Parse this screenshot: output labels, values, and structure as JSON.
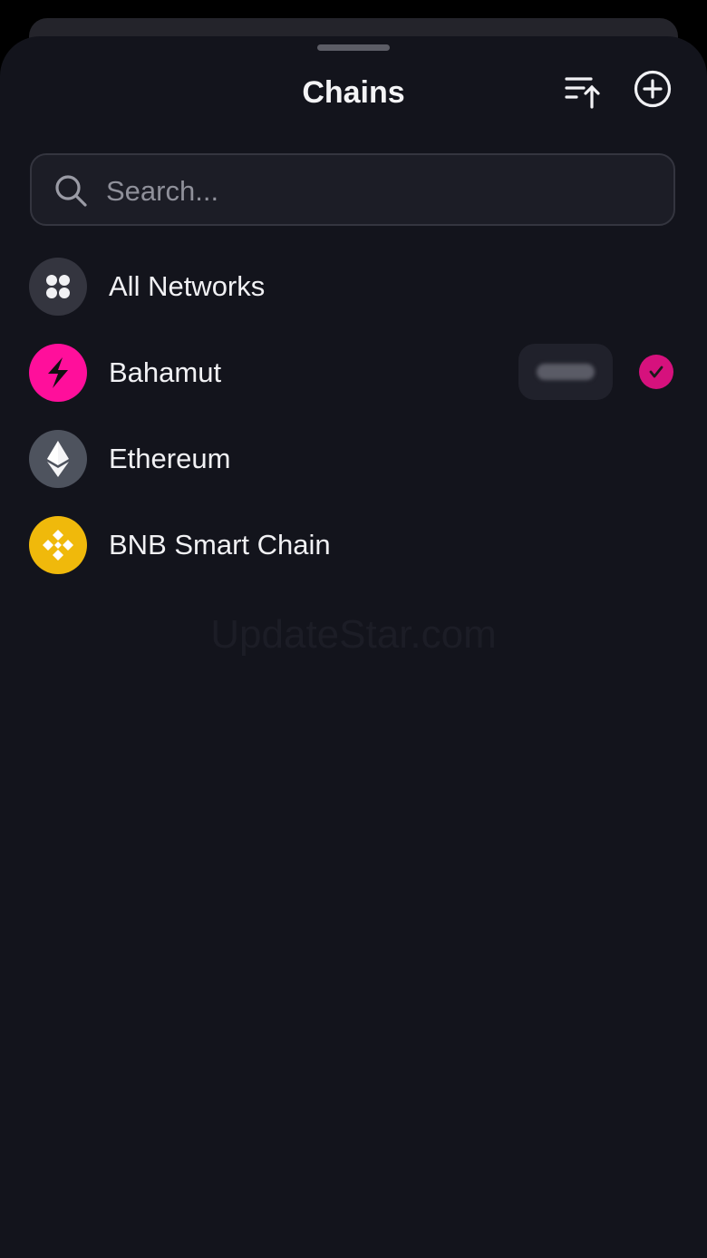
{
  "header": {
    "title": "Chains",
    "sort_icon": "sort-ascending-icon",
    "add_icon": "plus-circle-icon"
  },
  "search": {
    "placeholder": "Search...",
    "value": "",
    "icon": "search-icon"
  },
  "networks": [
    {
      "label": "All Networks",
      "icon": "grid-dots-icon",
      "selected": false
    },
    {
      "label": "Bahamut",
      "icon": "bahamut-bolt-icon",
      "selected": true
    },
    {
      "label": "Ethereum",
      "icon": "ethereum-icon",
      "selected": false
    },
    {
      "label": "BNB Smart Chain",
      "icon": "bnb-icon",
      "selected": false
    }
  ],
  "watermark": "UpdateStar.com",
  "colors": {
    "background": "#13141c",
    "accent": "#d6117d",
    "bahamut": "#ff0f9b",
    "bnb": "#f0b90b",
    "ethereum": "#4e535e"
  }
}
